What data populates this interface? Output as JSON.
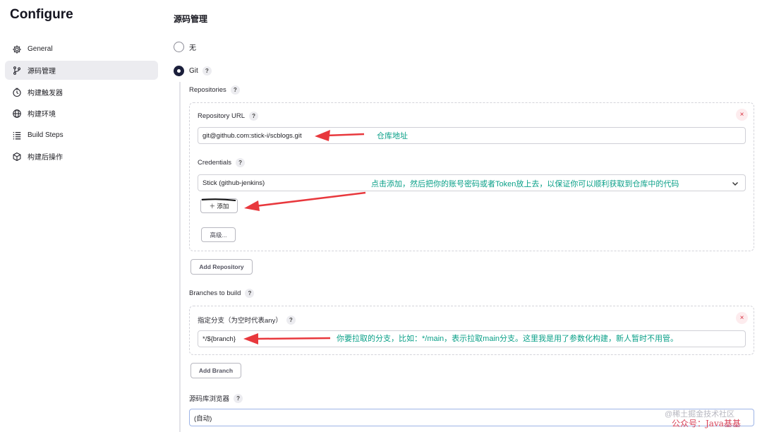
{
  "sidebar": {
    "title": "Configure",
    "items": [
      {
        "label": "General",
        "icon": "gear-icon"
      },
      {
        "label": "源码管理",
        "icon": "branch-icon"
      },
      {
        "label": "构建触发器",
        "icon": "clock-icon"
      },
      {
        "label": "构建环境",
        "icon": "globe-icon"
      },
      {
        "label": "Build Steps",
        "icon": "list-icon"
      },
      {
        "label": "构建后操作",
        "icon": "cube-icon"
      }
    ],
    "active_index": 1
  },
  "scm": {
    "section_title": "源码管理",
    "option_none": "无",
    "option_git": "Git",
    "selected": "Git",
    "help_mark": "?",
    "repositories_label": "Repositories",
    "repository_url_label": "Repository URL",
    "repository_url_value": "git@github.com:stick-i/scblogs.git",
    "credentials_label": "Credentials",
    "credentials_value": "Stick (github-jenkins)",
    "add_button": "＋ 添加",
    "advanced_button": "高级...",
    "add_repository_button": "Add Repository",
    "branches_label": "Branches to build",
    "branch_specifier_label": "指定分支（为空时代表any）",
    "branch_specifier_value": "*/${branch}",
    "add_branch_button": "Add Branch",
    "repo_browser_label": "源码库浏览器",
    "repo_browser_value": "(自动)",
    "close_symbol": "×"
  },
  "annotations": {
    "repo_address": "仓库地址",
    "credentials_hint": "点击添加，然后把你的账号密码或者Token放上去，以保证你可以顺利获取到仓库中的代码",
    "branch_hint": "你要拉取的分支，比如：*/main，表示拉取main分支。这里我是用了参数化构建，新人暂时不用管。",
    "arrow_color": "#e8383d",
    "text_color": "#0aa088"
  },
  "watermark": {
    "line1": "@稀土掘金技术社区",
    "line2": "公众号：Java基基"
  }
}
